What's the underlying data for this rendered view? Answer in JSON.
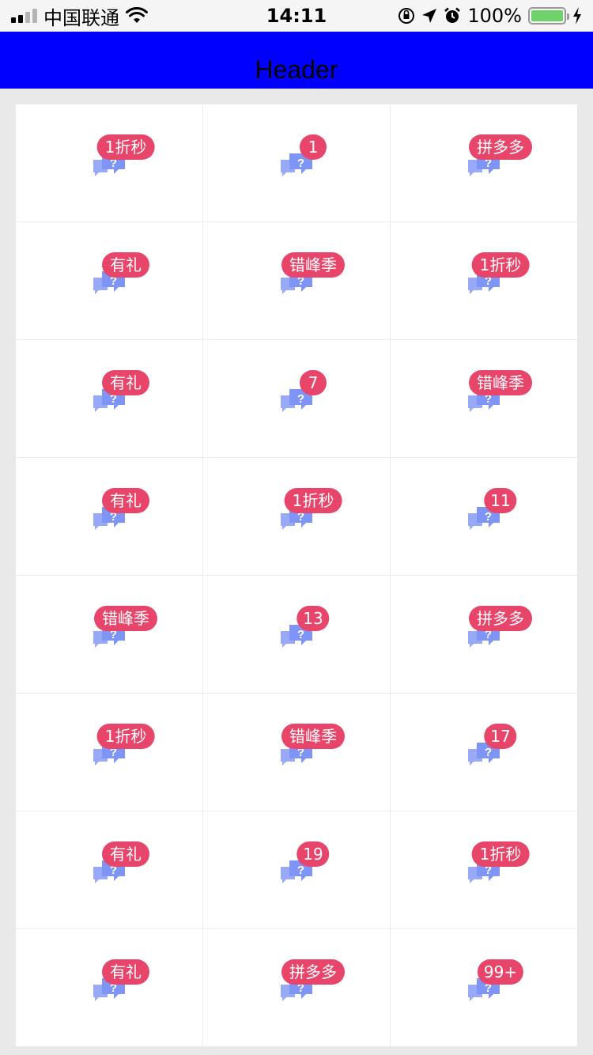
{
  "status_bar": {
    "carrier": "中国联通",
    "time": "14:11",
    "battery_text": "100%"
  },
  "header": {
    "title": "Header"
  },
  "colors": {
    "header_bg": "#0000ff",
    "badge_bg": "#e8456b",
    "icon_color": "#7e95f5"
  },
  "icon_name": "chat-question-icon",
  "grid": {
    "cells": [
      {
        "badge": "1折秒"
      },
      {
        "badge": "1"
      },
      {
        "badge": "拼多多"
      },
      {
        "badge": "有礼"
      },
      {
        "badge": "错峰季"
      },
      {
        "badge": "1折秒"
      },
      {
        "badge": "有礼"
      },
      {
        "badge": "7"
      },
      {
        "badge": "错峰季"
      },
      {
        "badge": "有礼"
      },
      {
        "badge": "1折秒"
      },
      {
        "badge": "11"
      },
      {
        "badge": "错峰季"
      },
      {
        "badge": "13"
      },
      {
        "badge": "拼多多"
      },
      {
        "badge": "1折秒"
      },
      {
        "badge": "错峰季"
      },
      {
        "badge": "17"
      },
      {
        "badge": "有礼"
      },
      {
        "badge": "19"
      },
      {
        "badge": "1折秒"
      },
      {
        "badge": "有礼"
      },
      {
        "badge": "拼多多"
      },
      {
        "badge": "99+"
      }
    ]
  }
}
